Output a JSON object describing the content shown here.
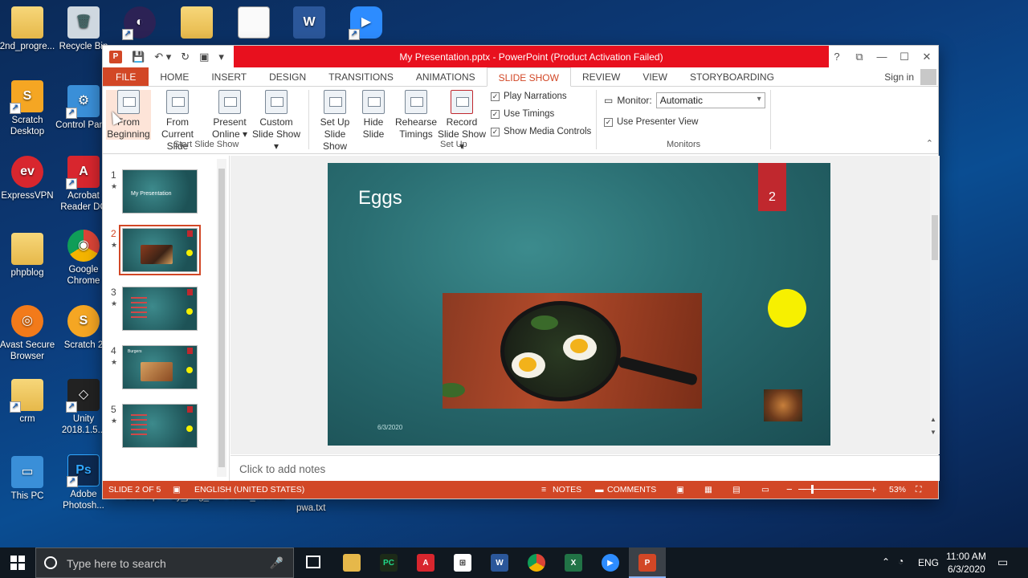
{
  "desktop": {
    "icons": [
      {
        "label": "2nd_progre...",
        "color": "#e6b84a",
        "glyph": ""
      },
      {
        "label": "Recycle Bin",
        "color": "#9ab",
        "glyph": "🗑"
      },
      {
        "label": "",
        "color": "#3c2f7d",
        "glyph": "◐"
      },
      {
        "label": "",
        "color": "#e6b84a",
        "glyph": ""
      },
      {
        "label": "",
        "color": "#fafafa",
        "glyph": ""
      },
      {
        "label": "",
        "color": "#2b579a",
        "glyph": "W"
      },
      {
        "label": "",
        "color": "#2d8cff",
        "glyph": "▶"
      },
      {
        "label": "Scratch Desktop",
        "color": "#f5a623",
        "glyph": "S"
      },
      {
        "label": "Control Panel",
        "color": "#3a8fd8",
        "glyph": "⚙"
      },
      {
        "label": "ExpressVPN",
        "color": "#d8262e",
        "glyph": "ev"
      },
      {
        "label": "Acrobat Reader DC",
        "color": "#d8262e",
        "glyph": "A"
      },
      {
        "label": "phpblog",
        "color": "#e6b84a",
        "glyph": ""
      },
      {
        "label": "Google Chrome",
        "color": "#2a9d49",
        "glyph": "◉"
      },
      {
        "label": "Avast Secure Browser",
        "color": "#f27a1a",
        "glyph": "◎"
      },
      {
        "label": "Scratch 2",
        "color": "#f5a623",
        "glyph": "🐱"
      },
      {
        "label": "crm",
        "color": "#e6b84a",
        "glyph": ""
      },
      {
        "label": "Unity 2018.1.5...",
        "color": "#333",
        "glyph": "◇"
      },
      {
        "label": "This PC",
        "color": "#3a8fd8",
        "glyph": "🖥"
      },
      {
        "label": "Adobe Photosh...",
        "color": "#0d2a52",
        "glyph": "Ps"
      }
    ],
    "partial_labels": [
      "desktop",
      "zy_jeng_o....",
      "colab_Monitor",
      "pwa.txt"
    ]
  },
  "window": {
    "title": "My Presentation.pptx - PowerPoint (Product Activation Failed)",
    "help": "?",
    "controls": [
      "⧉",
      "—",
      "☐",
      "✕"
    ]
  },
  "tabs": [
    "FILE",
    "HOME",
    "INSERT",
    "DESIGN",
    "TRANSITIONS",
    "ANIMATIONS",
    "SLIDE SHOW",
    "REVIEW",
    "VIEW",
    "STORYBOARDING"
  ],
  "active_tab": "SLIDE SHOW",
  "signin": "Sign in",
  "ribbon": {
    "from_beginning": "From Beginning",
    "from_current": "From Current Slide",
    "present_online": "Present Online",
    "custom_show": "Custom Slide Show",
    "group_start": "Start Slide Show",
    "setup_show": "Set Up Slide Show",
    "hide_slide": "Hide Slide",
    "rehearse": "Rehearse Timings",
    "record": "Record Slide Show",
    "play_narrations": "Play Narrations",
    "use_timings": "Use Timings",
    "show_media": "Show Media Controls",
    "group_setup": "Set Up",
    "monitor_label": "Monitor:",
    "monitor_value": "Automatic",
    "presenter_view": "Use Presenter View",
    "group_monitors": "Monitors"
  },
  "slides": [
    {
      "num": "1",
      "title": "My Presentation"
    },
    {
      "num": "2",
      "title": "Eggs"
    },
    {
      "num": "3",
      "title": ""
    },
    {
      "num": "4",
      "title": "Burgers"
    },
    {
      "num": "5",
      "title": ""
    }
  ],
  "current_slide": {
    "title": "Eggs",
    "number": "2",
    "date": "6/3/2020"
  },
  "notes_placeholder": "Click to add notes",
  "status": {
    "slide": "SLIDE 2 OF 5",
    "language": "ENGLISH (UNITED STATES)",
    "notes": "NOTES",
    "comments": "COMMENTS",
    "zoom": "53%",
    "zoom_minus": "−",
    "zoom_plus": "+"
  },
  "taskbar": {
    "search_placeholder": "Type here to search",
    "lang": "ENG",
    "time": "11:00 AM",
    "date": "6/3/2020"
  }
}
